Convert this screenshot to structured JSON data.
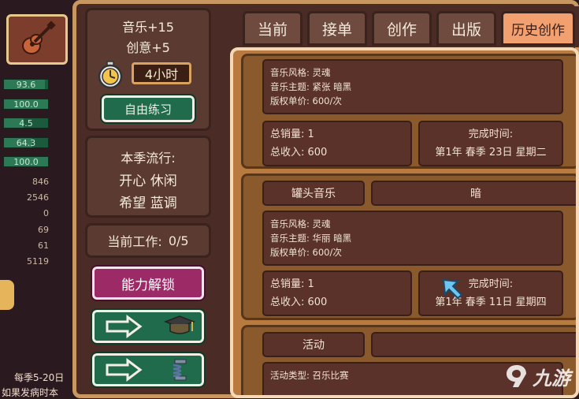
{
  "left_strip": {
    "bars": [
      {
        "value": "93.6",
        "fill": 0.936
      },
      {
        "value": "100.0",
        "fill": 1.0
      },
      {
        "value": "4.5",
        "fill": 0.45
      },
      {
        "value": "64.3",
        "fill": 0.643
      },
      {
        "value": "100.0",
        "fill": 1.0
      }
    ],
    "numbers": [
      "846",
      "2546",
      "0",
      "69",
      "61",
      "5119"
    ],
    "bottom_line1": "每季5-20日",
    "bottom_line2": "如果发病时本"
  },
  "practice": {
    "music_bonus": "音乐+15",
    "creativity_bonus": "创意+5",
    "hours": "4小时",
    "free_practice_label": "自由练习"
  },
  "trend": {
    "title": "本季流行:",
    "line1": "开心 休闲",
    "line2": "希望 蓝调"
  },
  "work": {
    "label": "当前工作:",
    "count": "0/5"
  },
  "unlock_label": "能力解锁",
  "tabs": [
    "当前",
    "接单",
    "创作",
    "出版",
    "历史创作"
  ],
  "history": [
    {
      "style": "音乐风格:  灵魂",
      "theme": "音乐主题:  紧张  暗黑",
      "royalty": "版权单价:  600/次",
      "sales": "总销量:  1",
      "income": "总收入:  600",
      "time_label": "完成时间:",
      "time_value": "第1年  春季  23日   星期二"
    },
    {
      "name": "罐头音乐",
      "tag": "暗",
      "style": "音乐风格:  灵魂",
      "theme": "音乐主题:  华丽  暗黑",
      "royalty": "版权单价:  600/次",
      "sales": "总销量:  1",
      "income": "总收入:  600",
      "time_label": "完成时间:",
      "time_value": "第1年  春季  11日   星期四"
    },
    {
      "name": "活动",
      "partial": "活动类型:  召乐比赛"
    }
  ],
  "watermark": "九游",
  "colors": {
    "active_tab": "#f2a070",
    "green_button": "#1f6b4c",
    "unlock_button": "#9c2a66"
  }
}
